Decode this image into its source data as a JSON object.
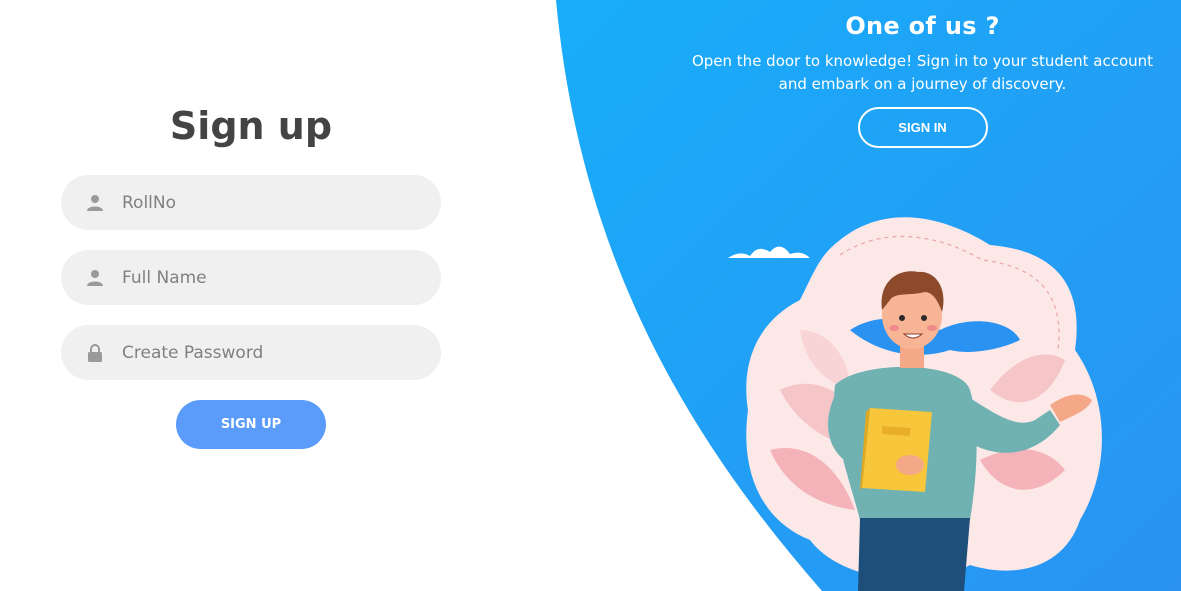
{
  "panel": {
    "title": "One of us ?",
    "text": "Open the door to knowledge! Sign in to your student account and embark on a journey of discovery.",
    "signin_label": "SIGN IN"
  },
  "form": {
    "title": "Sign up",
    "rollno_placeholder": "RollNo",
    "fullname_placeholder": "Full Name",
    "password_placeholder": "Create Password",
    "signup_label": "SIGN UP"
  },
  "icons": {
    "rollno": "user-icon",
    "fullname": "user-icon",
    "password": "lock-icon"
  },
  "colors": {
    "panel_blue": "#1fa9f8",
    "signup_button": "#5b9bfa",
    "field_bg": "#f0f0f0",
    "title_text": "#444444"
  }
}
